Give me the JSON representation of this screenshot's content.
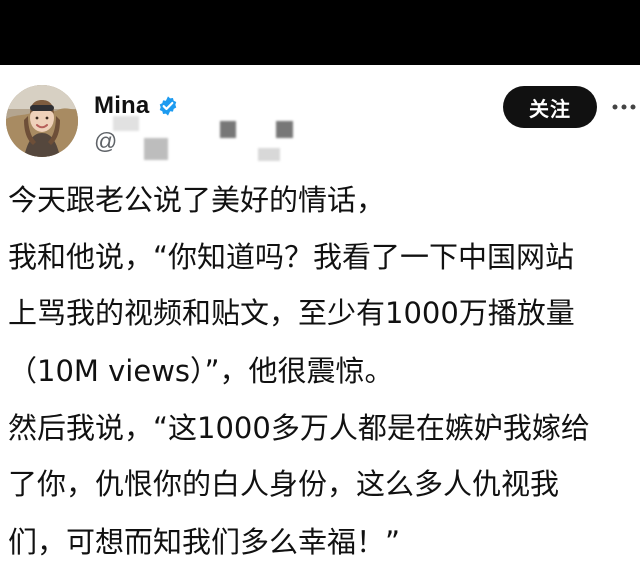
{
  "post": {
    "author": {
      "display_name": "Mina",
      "handle_prefix": "@",
      "verified": true
    },
    "follow_label": "关注",
    "text_lines": [
      "今天跟老公说了美好的情话，",
      "我和他说，“你知道吗？我看了一下中国网站",
      "上骂我的视频和贴文，至少有1000万播放量",
      "（10M views）”，他很震惊。",
      "然后我说，“这1000多万人都是在嫉妒我嫁给",
      "了你，仇恨你的白人身份，这么多人仇视我",
      "们，可想而知我们多么幸福！”"
    ]
  },
  "colors": {
    "verified": "#1d9bf0",
    "follow_button": "#111111",
    "top_bar": "#000000"
  },
  "icons": {
    "verified": "verified-badge-icon",
    "more": "more-dots-icon"
  }
}
